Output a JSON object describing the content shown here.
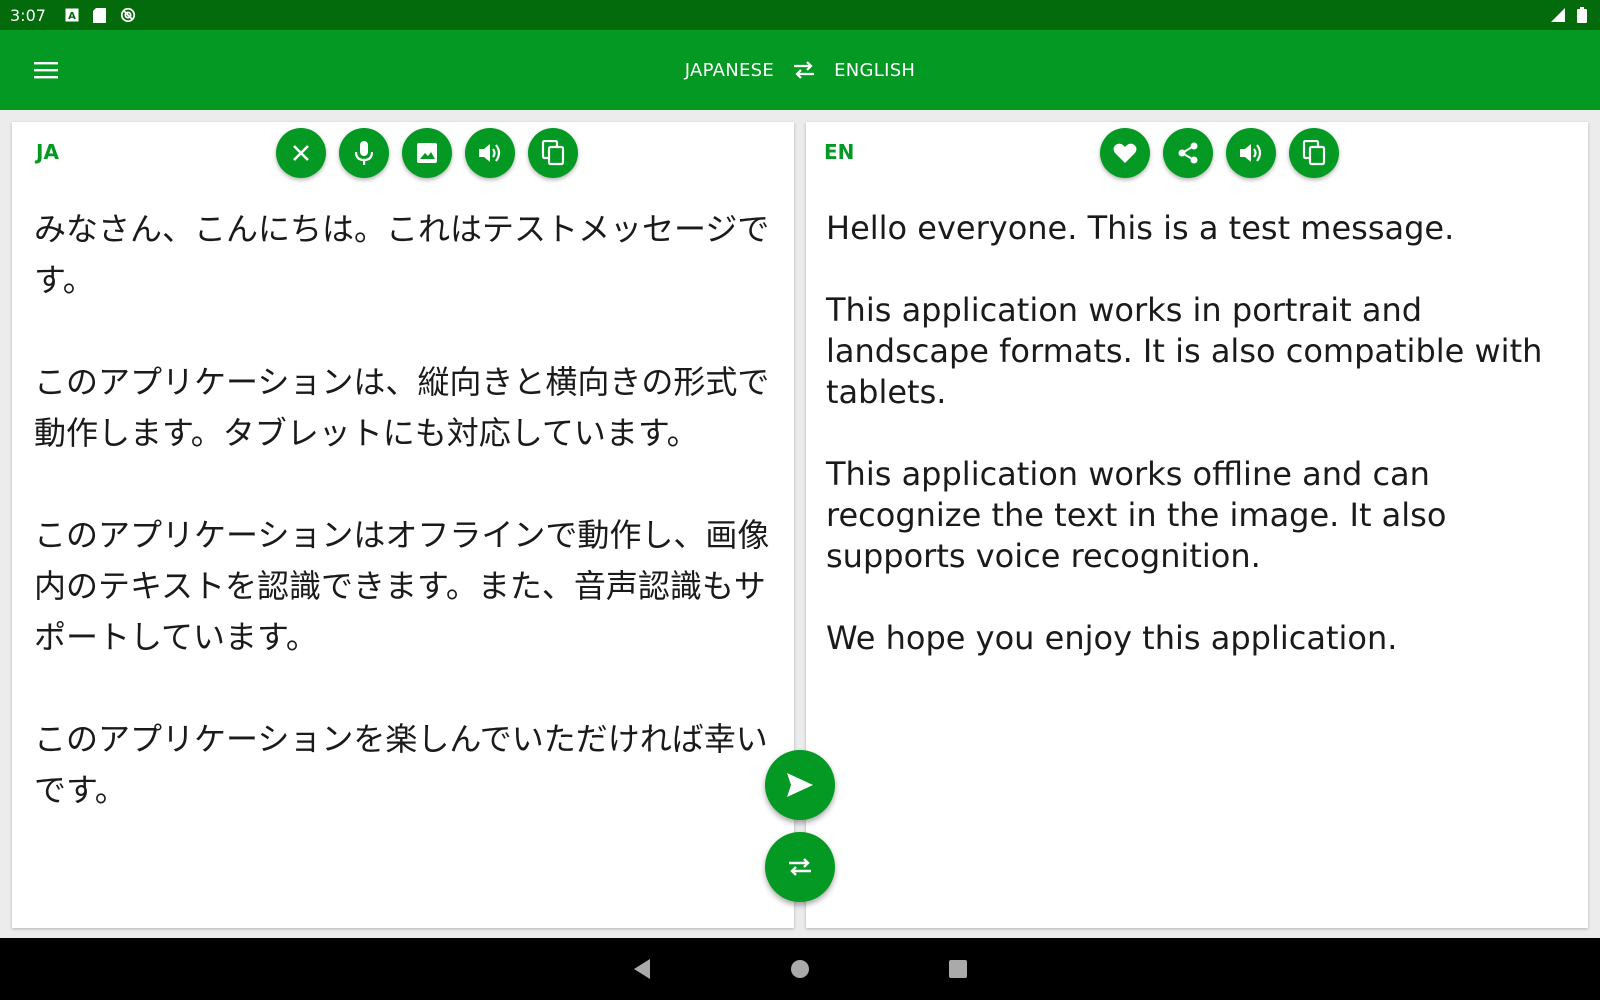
{
  "status_bar": {
    "time": "3:07",
    "left_icons": [
      "a-notification-icon",
      "sd-card-icon",
      "sync-icon"
    ],
    "right_icons": [
      "signal-icon",
      "battery-icon"
    ]
  },
  "app_bar": {
    "source_language": "JAPANESE",
    "target_language": "ENGLISH"
  },
  "source_panel": {
    "code": "JA",
    "text": "みなさん、こんにちは。これはテストメッセージです。\n\nこのアプリケーションは、縦向きと横向きの形式で動作します。タブレットにも対応しています。\n\nこのアプリケーションはオフラインで動作し、画像内のテキストを認識できます。また、音声認識もサポートしています。\n\nこのアプリケーションを楽しんでいただければ幸いです。",
    "tools": [
      "clear-icon",
      "microphone-icon",
      "image-icon",
      "speaker-icon",
      "copy-icon"
    ]
  },
  "target_panel": {
    "code": "EN",
    "text": "Hello everyone. This is a test message.\n\nThis application works in portrait and landscape formats. It is also compatible with tablets.\n\nThis application works offline and can recognize the text in the image. It also supports voice recognition.\n\nWe hope you enjoy this application.",
    "tools": [
      "heart-icon",
      "share-icon",
      "speaker-icon",
      "copy-icon"
    ]
  },
  "colors": {
    "status_bar": "#036b0b",
    "app_bar": "#039922",
    "accent": "#039922",
    "nav_bar": "#000000"
  }
}
